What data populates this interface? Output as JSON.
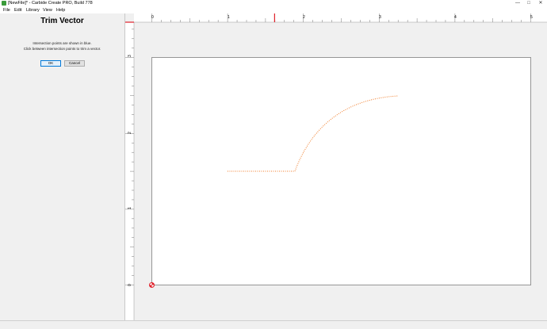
{
  "window": {
    "title": "[NewFile]* - Carbide Create PRO, Build 778",
    "minimize_glyph": "—",
    "maximize_glyph": "□",
    "close_glyph": "✕"
  },
  "menu": {
    "items": [
      "File",
      "Edit",
      "Library",
      "View",
      "Help"
    ]
  },
  "panel": {
    "title": "Trim Vector",
    "line1": "Intersection points are shown in blue.",
    "line2": "Click between intersection points to trim a vector.",
    "ok_label": "OK",
    "cancel_label": "Cancel"
  },
  "ruler": {
    "x_labels": [
      "0",
      "1",
      "2",
      "3",
      "4",
      "5"
    ],
    "y_labels": [
      "3",
      "2",
      "1",
      "0"
    ],
    "cursor_x": 1.62
  },
  "colors": {
    "vector": "#f07c28",
    "cursor": "#e0202a",
    "origin": "#e0202a"
  },
  "icons": {
    "app": "carbide-app-icon",
    "origin": "origin-marker-icon"
  }
}
